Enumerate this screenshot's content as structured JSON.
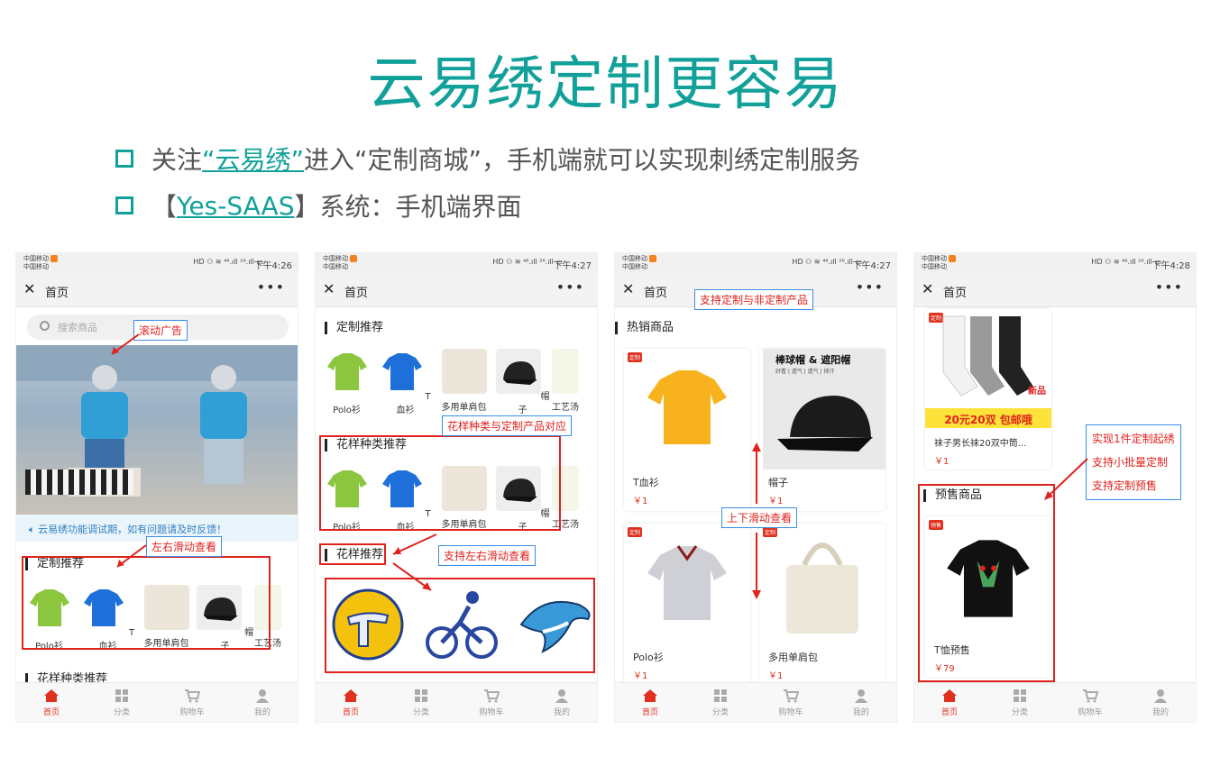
{
  "title": "云易绣定制更容易",
  "bullets": {
    "b1_pre": "关注",
    "b1_link": "“云易绣”",
    "b1_post": " 进入“定制商城”，手机端就可以实现刺绣定制服务",
    "b2_pre": "【",
    "b2_link": "Yes-SAAS",
    "b2_post": "】系统：手机端界面"
  },
  "status": {
    "carrier1": "中国移动",
    "carrier2": "中国移动",
    "icons": "HD ⚇ ≋ ⁴⁶.ıll ²⁶.ıll ▭",
    "times": [
      "下午4:26",
      "下午4:27",
      "下午4:27",
      "下午4:28"
    ]
  },
  "nav": {
    "close": "✕",
    "title": "首页",
    "more": "•••"
  },
  "tabs": [
    "首页",
    "分类",
    "购物车",
    "我的"
  ],
  "phone1": {
    "search_placeholder": "搜索商品",
    "notice": "云易绣功能调试期，如有问题请及时反馈！",
    "section1": "定制推荐",
    "section2": "花样种类推荐",
    "products": [
      "Polo衫",
      "T血衫",
      "多用单肩包",
      "帽子",
      "工艺汤"
    ],
    "callout_ad": "滚动广告",
    "callout_scroll": "左右滑动查看"
  },
  "phone2": {
    "section1": "定制推荐",
    "section2": "花样种类推荐",
    "section3": "花样推荐",
    "products1": [
      "Polo衫",
      "T血衫",
      "多用单肩包",
      "帽子",
      "工艺汤"
    ],
    "products2": [
      "Polo衫",
      "T血衫",
      "多用单肩包",
      "帽子",
      "工艺汤"
    ],
    "callout_match": "花样种类与定制产品对应",
    "callout_scroll": "支持左右滑动查看"
  },
  "phone3": {
    "callout_top": "支持定制与非定制产品",
    "section": "热销商品",
    "callout_mid": "上下滑动查看",
    "badge": "定制",
    "cap_banner": "棒球帽 & 遮阳帽",
    "cap_sub": "好看 | 透气 | 透气 | 排汗",
    "items": [
      {
        "name": "T血衫",
        "price": "￥1"
      },
      {
        "name": "帽子",
        "price": "￥1"
      },
      {
        "name": "Polo衫",
        "price": "￥1"
      },
      {
        "name": "多用单肩包",
        "price": "￥1"
      }
    ]
  },
  "phone4": {
    "badge": "定制",
    "badge2": "预售",
    "sock_promo": "20元20双 包邮哦",
    "sock_new": "新品",
    "sock_name": "袜子男长袜20双中筒...",
    "sock_price": "￥1",
    "section": "预售商品",
    "tee_name": "T恤预售",
    "tee_price": "￥79",
    "callout_lines": [
      "实现1件定制起绣",
      "支持小批量定制",
      "支持定制预售"
    ]
  },
  "colors": {
    "accent": "#12a19a",
    "red": "#e0221d",
    "callout_border": "#3a8ee6"
  }
}
